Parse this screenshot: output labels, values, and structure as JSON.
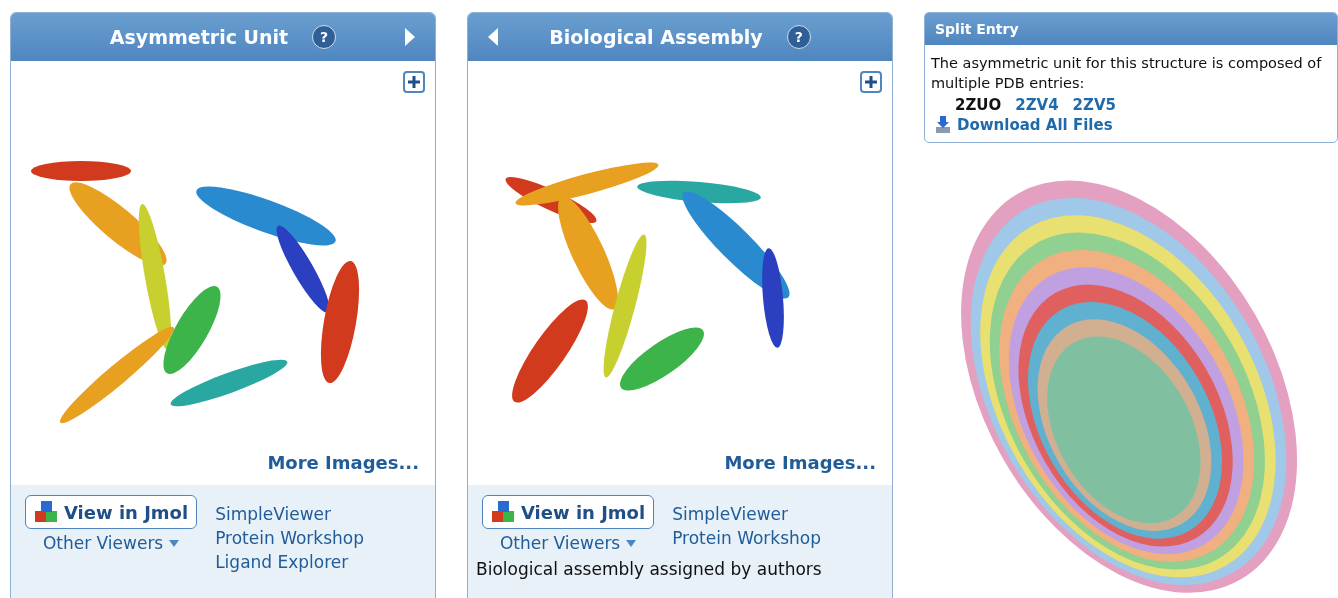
{
  "panels": [
    {
      "title": "Asymmetric Unit",
      "help": "?",
      "prev": false,
      "next": true,
      "more_images": "More Images...",
      "jmol": "View in Jmol",
      "other_viewers": "Other Viewers",
      "links": [
        "SimpleViewer",
        "Protein Workshop",
        "Ligand Explorer"
      ]
    },
    {
      "title": "Biological Assembly",
      "help": "?",
      "prev": true,
      "next": false,
      "more_images": "More Images...",
      "jmol": "View in Jmol",
      "other_viewers": "Other Viewers",
      "links": [
        "SimpleViewer",
        "Protein Workshop"
      ],
      "note": "Biological assembly assigned by authors"
    }
  ],
  "split_entry": {
    "title": "Split Entry",
    "text": "The asymmetric unit for this structure is composed of multiple PDB entries:",
    "entries": [
      {
        "id": "2ZUO",
        "selected": true
      },
      {
        "id": "2ZV4",
        "selected": false
      },
      {
        "id": "2ZV5",
        "selected": false
      }
    ],
    "download": "Download All Files"
  }
}
